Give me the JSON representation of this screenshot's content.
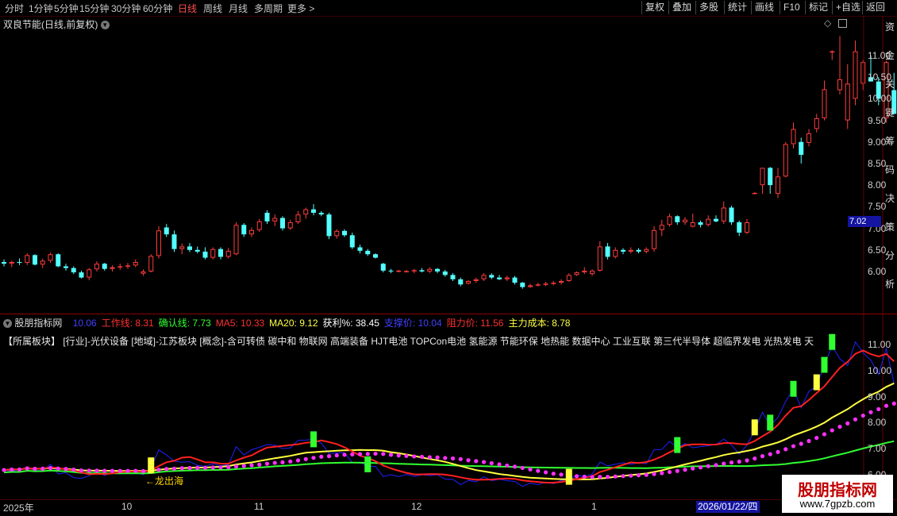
{
  "topbar": {
    "left_tabs": [
      {
        "label": "分时",
        "x": 6
      },
      {
        "label": "1分钟",
        "x": 36
      },
      {
        "label": "5分钟",
        "x": 68
      },
      {
        "label": "15分钟",
        "x": 100
      },
      {
        "label": "30分钟",
        "x": 140
      },
      {
        "label": "60分钟",
        "x": 180
      },
      {
        "label": "日线",
        "x": 224,
        "active": true
      },
      {
        "label": "周线",
        "x": 256
      },
      {
        "label": "月线",
        "x": 288
      },
      {
        "label": "多周期",
        "x": 320
      },
      {
        "label": "更多 >",
        "x": 362
      }
    ],
    "right_buttons": [
      "复权",
      "叠加",
      "多股",
      "统计",
      "画线",
      "F10",
      "标记",
      "+自选",
      "返回"
    ]
  },
  "main": {
    "title": "双良节能(日线,前复权)",
    "y_ticks": [
      "11.00",
      "10.50",
      "10.00",
      "9.50",
      "9.00",
      "8.50",
      "8.00",
      "7.50",
      "7.00",
      "6.50",
      "6.00"
    ],
    "current_price": "7.02",
    "right_strip_chars": "资金关键筹码决策分析"
  },
  "indicator": {
    "name": "股朋指标网",
    "values": [
      {
        "text": "10.06",
        "color": "#4040ff"
      },
      {
        "text": "工作线: 8.31",
        "color": "#ff3030"
      },
      {
        "text": "确认线: 7.73",
        "color": "#30ff30"
      },
      {
        "text": "MA5: 10.33",
        "color": "#ff3030"
      },
      {
        "text": "MA20: 9.12",
        "color": "#ffff40"
      },
      {
        "text": "获利%: 38.45",
        "color": "#ffffff"
      },
      {
        "text": "支撑价: 10.04",
        "color": "#4040ff"
      },
      {
        "text": "阻力价: 11.56",
        "color": "#ff3030"
      },
      {
        "text": "主力成本: 8.78",
        "color": "#ffff40"
      }
    ],
    "sector_text": "【所属板块】  [行业]-光伏设备   [地域]-江苏板块   [概念]-含可转债 碳中和 物联网 高端装备 HJT电池 TOPCon电池 氢能源 节能环保 地热能 数据中心 工业互联 第三代半导体 超临界发电 光热发电 天",
    "y_ticks": [
      "11.00",
      "10.00",
      "9.00",
      "8.00",
      "7.00",
      "6.00"
    ],
    "annotation": "←龙出海"
  },
  "date_axis": {
    "ticks": [
      {
        "label": "2025年",
        "x": 4
      },
      {
        "label": "10",
        "x": 153
      },
      {
        "label": "11",
        "x": 320
      },
      {
        "label": "12",
        "x": 518
      },
      {
        "label": "1",
        "x": 745
      }
    ],
    "cursor_date": "2026/01/22/四"
  },
  "watermark": {
    "title": "股朋指标网",
    "url": "www.7gpzb.com"
  },
  "chart_data": {
    "type": "candlestick",
    "title": "双良节能(日线,前复权)",
    "ylim": [
      5.4,
      11.75
    ],
    "y_ticks": [
      6.0,
      6.5,
      7.0,
      7.5,
      8.0,
      8.5,
      9.0,
      9.5,
      10.0,
      10.5,
      11.0
    ],
    "colors": {
      "up": "#ff3c3c",
      "down": "#54ffff"
    },
    "ohlc": [
      [
        6.22,
        6.28,
        6.12,
        6.18
      ],
      [
        6.18,
        6.25,
        6.1,
        6.22
      ],
      [
        6.22,
        6.3,
        6.15,
        6.2
      ],
      [
        6.2,
        6.42,
        6.15,
        6.38
      ],
      [
        6.38,
        6.4,
        6.14,
        6.16
      ],
      [
        6.16,
        6.3,
        6.08,
        6.25
      ],
      [
        6.25,
        6.44,
        6.2,
        6.4
      ],
      [
        6.4,
        6.42,
        6.1,
        6.12
      ],
      [
        6.12,
        6.18,
        6.02,
        6.08
      ],
      [
        6.08,
        6.12,
        5.94,
        5.98
      ],
      [
        5.98,
        6.02,
        5.84,
        5.86
      ],
      [
        5.86,
        6.08,
        5.8,
        6.05
      ],
      [
        6.05,
        6.24,
        6.0,
        6.18
      ],
      [
        6.18,
        6.2,
        6.02,
        6.06
      ],
      [
        6.06,
        6.14,
        6.0,
        6.1
      ],
      [
        6.1,
        6.18,
        6.04,
        6.12
      ],
      [
        6.12,
        6.2,
        6.06,
        6.14
      ],
      [
        6.14,
        6.28,
        6.1,
        6.22
      ],
      [
        5.95,
        6.05,
        5.9,
        6.0
      ],
      [
        6.0,
        6.4,
        5.98,
        6.36
      ],
      [
        6.36,
        7.05,
        6.3,
        6.95
      ],
      [
        7.02,
        7.1,
        6.8,
        6.86
      ],
      [
        6.86,
        6.95,
        6.45,
        6.52
      ],
      [
        6.52,
        6.65,
        6.4,
        6.58
      ],
      [
        6.58,
        6.66,
        6.45,
        6.5
      ],
      [
        6.5,
        6.58,
        6.42,
        6.46
      ],
      [
        6.46,
        6.56,
        6.28,
        6.32
      ],
      [
        6.32,
        6.56,
        6.28,
        6.52
      ],
      [
        6.52,
        6.56,
        6.28,
        6.34
      ],
      [
        6.34,
        6.55,
        6.3,
        6.48
      ],
      [
        6.4,
        7.14,
        6.38,
        7.08
      ],
      [
        7.08,
        7.12,
        6.8,
        6.86
      ],
      [
        6.86,
        7.02,
        6.8,
        6.96
      ],
      [
        6.96,
        7.22,
        6.92,
        7.16
      ],
      [
        7.36,
        7.42,
        7.1,
        7.16
      ],
      [
        7.16,
        7.32,
        7.05,
        7.24
      ],
      [
        7.24,
        7.28,
        6.95,
        7.0
      ],
      [
        7.0,
        7.2,
        6.96,
        7.14
      ],
      [
        7.14,
        7.4,
        7.1,
        7.32
      ],
      [
        7.32,
        7.48,
        7.22,
        7.44
      ],
      [
        7.44,
        7.56,
        7.3,
        7.36
      ],
      [
        7.36,
        7.4,
        7.28,
        7.32
      ],
      [
        7.32,
        7.36,
        6.75,
        6.82
      ],
      [
        6.82,
        6.98,
        6.76,
        6.94
      ],
      [
        6.94,
        6.98,
        6.8,
        6.84
      ],
      [
        6.84,
        6.9,
        6.52,
        6.56
      ],
      [
        6.56,
        6.62,
        6.42,
        6.48
      ],
      [
        6.48,
        6.52,
        6.36,
        6.4
      ],
      [
        6.4,
        6.42,
        6.3,
        6.32
      ],
      [
        6.18,
        6.2,
        5.98,
        6.02
      ],
      [
        6.02,
        6.06,
        5.96,
        6.0
      ],
      [
        6.02,
        6.04,
        5.98,
        6.02
      ],
      [
        6.0,
        6.04,
        5.98,
        6.01
      ],
      [
        6.01,
        6.06,
        5.96,
        6.03
      ],
      [
        6.03,
        6.08,
        5.98,
        6.0
      ],
      [
        6.0,
        6.1,
        5.96,
        6.06
      ],
      [
        6.06,
        6.08,
        5.96,
        6.0
      ],
      [
        6.0,
        6.04,
        5.88,
        5.92
      ],
      [
        5.92,
        5.96,
        5.78,
        5.82
      ],
      [
        5.82,
        5.86,
        5.66,
        5.7
      ],
      [
        5.72,
        5.8,
        5.7,
        5.78
      ],
      [
        5.78,
        5.86,
        5.74,
        5.82
      ],
      [
        5.82,
        5.96,
        5.78,
        5.92
      ],
      [
        5.92,
        5.96,
        5.82,
        5.86
      ],
      [
        5.86,
        5.92,
        5.8,
        5.82
      ],
      [
        5.82,
        5.9,
        5.78,
        5.86
      ],
      [
        5.86,
        5.9,
        5.7,
        5.74
      ],
      [
        5.74,
        5.76,
        5.6,
        5.64
      ],
      [
        5.64,
        5.72,
        5.62,
        5.68
      ],
      [
        5.68,
        5.74,
        5.66,
        5.7
      ],
      [
        5.7,
        5.76,
        5.66,
        5.72
      ],
      [
        5.72,
        5.78,
        5.68,
        5.74
      ],
      [
        5.74,
        5.82,
        5.7,
        5.78
      ],
      [
        5.78,
        5.96,
        5.76,
        5.92
      ],
      [
        5.92,
        6.0,
        5.9,
        5.98
      ],
      [
        5.98,
        6.1,
        5.94,
        6.02
      ],
      [
        5.94,
        6.05,
        5.9,
        6.02
      ],
      [
        6.02,
        6.7,
        6.0,
        6.58
      ],
      [
        6.58,
        6.66,
        6.28,
        6.34
      ],
      [
        6.34,
        6.56,
        6.3,
        6.5
      ],
      [
        6.5,
        6.54,
        6.4,
        6.46
      ],
      [
        6.46,
        6.56,
        6.42,
        6.5
      ],
      [
        6.5,
        6.54,
        6.42,
        6.46
      ],
      [
        6.46,
        6.56,
        6.42,
        6.52
      ],
      [
        6.52,
        7.05,
        6.46,
        6.96
      ],
      [
        6.96,
        7.2,
        6.82,
        7.08
      ],
      [
        7.08,
        7.34,
        7.04,
        7.28
      ],
      [
        7.28,
        7.3,
        7.08,
        7.14
      ],
      [
        7.14,
        7.26,
        7.08,
        7.2
      ],
      [
        7.04,
        7.34,
        7.02,
        7.14
      ],
      [
        7.14,
        7.18,
        7.02,
        7.08
      ],
      [
        7.08,
        7.3,
        7.04,
        7.22
      ],
      [
        7.22,
        7.3,
        7.14,
        7.16
      ],
      [
        7.16,
        7.62,
        7.1,
        7.48
      ],
      [
        7.48,
        7.52,
        7.08,
        7.14
      ],
      [
        7.14,
        7.18,
        6.82,
        6.9
      ],
      [
        6.9,
        7.22,
        6.86,
        7.14
      ],
      [
        7.82,
        7.84,
        7.8,
        7.82
      ],
      [
        8.0,
        8.4,
        7.8,
        8.4
      ],
      [
        8.4,
        8.42,
        7.8,
        8.0
      ],
      [
        7.8,
        8.4,
        7.7,
        8.2
      ],
      [
        8.2,
        9.0,
        8.18,
        8.95
      ],
      [
        8.95,
        9.45,
        8.85,
        9.3
      ],
      [
        9.0,
        9.1,
        8.5,
        8.7
      ],
      [
        8.98,
        9.3,
        8.9,
        9.2
      ],
      [
        9.3,
        9.65,
        9.22,
        9.55
      ],
      [
        9.55,
        10.42,
        9.5,
        10.22
      ],
      [
        11.1,
        11.12,
        10.9,
        11.1
      ],
      [
        10.2,
        11.45,
        10.1,
        10.45
      ],
      [
        9.5,
        10.8,
        9.3,
        10.35
      ],
      [
        10.0,
        11.35,
        9.85,
        11.1
      ],
      [
        10.35,
        10.9,
        10.2,
        10.85
      ],
      [
        10.5,
        11.0,
        10.4,
        10.4
      ],
      [
        10.4,
        10.5,
        9.85,
        10.0
      ],
      [
        9.55,
        10.88,
        9.45,
        10.85
      ],
      [
        10.2,
        10.6,
        9.65,
        9.65
      ]
    ]
  }
}
